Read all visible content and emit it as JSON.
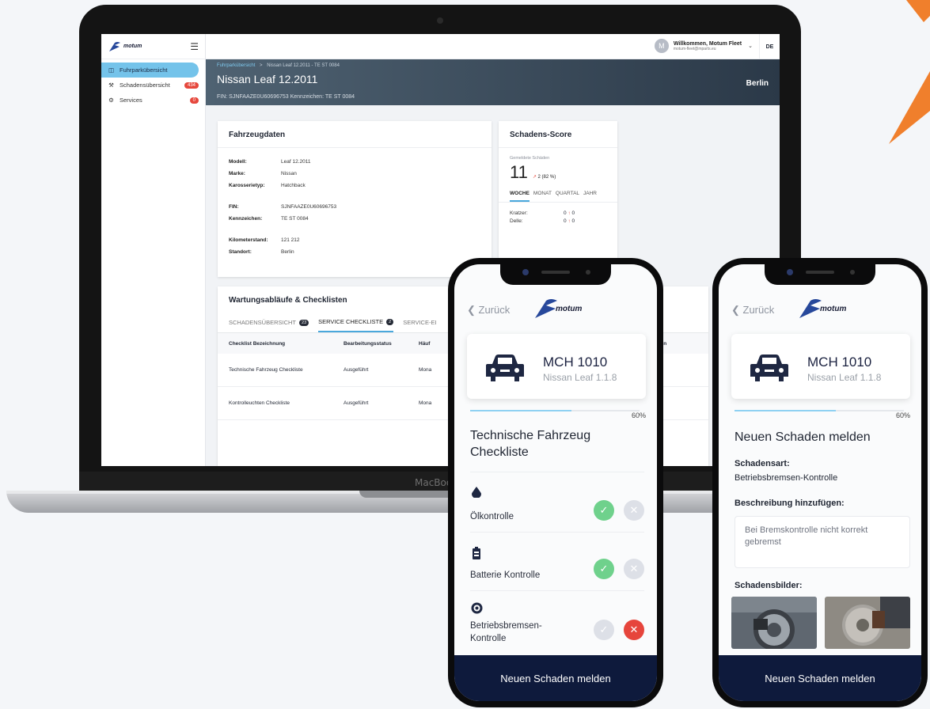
{
  "laptop": {
    "brand": "MacBook",
    "sidebar": {
      "logo": "motum",
      "items": [
        {
          "label": "Fuhrparkübersicht",
          "badge": ""
        },
        {
          "label": "Schadensübersicht",
          "badge": "434"
        },
        {
          "label": "Services",
          "badge": "0"
        }
      ]
    },
    "topbar": {
      "avatar": "M",
      "user_name": "Willkommen, Motum Fleet",
      "user_email": "motum-fleet@mparts.eu",
      "lang": "DE"
    },
    "header": {
      "breadcrumb_link": "Fuhrparkübersicht",
      "breadcrumb_sep": ">",
      "breadcrumb_current": "Nissan Leaf 12.2011 - TE ST 0084",
      "title": "Nissan Leaf 12.2011",
      "subtitle": "FIN: SJNFAAZE0U60696753   Kennzeichen: TE ST 0084",
      "city": "Berlin"
    },
    "vehicle": {
      "title": "Fahrzeugdaten",
      "fields": [
        {
          "k": "Modell:",
          "v": "Leaf 12.2011"
        },
        {
          "k": "Marke:",
          "v": "Nissan"
        },
        {
          "k": "Karosserietyp:",
          "v": "Hatchback"
        },
        {
          "k": "FIN:",
          "v": "SJNFAAZE0U60696753"
        },
        {
          "k": "Kennzeichen:",
          "v": "TE ST 0084"
        },
        {
          "k": "Kilometerstand:",
          "v": "121 212"
        },
        {
          "k": "Standort:",
          "v": "Berlin"
        }
      ]
    },
    "score": {
      "title": "Schadens-Score",
      "label": "Gemeldete Schäden",
      "value": "11",
      "delta": "2 (82 %)",
      "tabs": [
        "WOCHE",
        "MONAT",
        "QUARTAL",
        "JAHR"
      ],
      "rows": [
        {
          "k": "Kratzer:",
          "v": "0",
          "d": "0"
        },
        {
          "k": "Delle:",
          "v": "0",
          "d": "0"
        }
      ]
    },
    "maint": {
      "title": "Wartungsabläufe & Checklisten",
      "tabs": [
        {
          "label": "SCHADENSÜBERSICHT",
          "badge": "23"
        },
        {
          "label": "SERVICE CHECKLISTE",
          "badge": "2"
        },
        {
          "label": "SERVICE-EI",
          "badge": ""
        }
      ],
      "headers": [
        "Checklist Bezeichnung",
        "Bearbeitungsstatus",
        "Häuf",
        "aden"
      ],
      "rows": [
        [
          "Technische Fahrzeug Checkliste",
          "Ausgeführt",
          "Mona"
        ],
        [
          "Kontrolleuchten Checkliste",
          "Ausgeführt",
          "Mona"
        ]
      ]
    }
  },
  "phone1": {
    "back": "Zurück",
    "logo": "motum",
    "plate": "MCH 1010",
    "model": "Nissan Leaf 1.1.8",
    "progress_percent": 60,
    "progress_label": "60%",
    "title": "Technische Fahrzeug Checkliste",
    "items": [
      {
        "label": "Ölkontrolle",
        "status": "ok"
      },
      {
        "label": "Batterie Kontrolle",
        "status": "ok"
      },
      {
        "label": "Betriebsbremsen-Kontrolle",
        "status": "fail"
      }
    ],
    "button": "Neuen Schaden melden"
  },
  "phone2": {
    "back": "Zurück",
    "logo": "motum",
    "plate": "MCH 1010",
    "model": "Nissan Leaf 1.1.8",
    "progress_percent": 60,
    "progress_label": "60%",
    "title": "Neuen Schaden melden",
    "type_label": "Schadensart:",
    "type_value": "Betriebsbremsen-Kontrolle",
    "desc_label": "Beschreibung hinzufügen:",
    "desc_value": "Bei Bremskontrolle nicht korrekt gebremst",
    "images_label": "Schadensbilder:",
    "button": "Neuen Schaden melden"
  },
  "colors": {
    "accent": "#74c3ea",
    "navy": "#0e1a3c",
    "ok": "#6fd18c",
    "fail": "#e6453c",
    "arrow": "#f07f2c"
  }
}
